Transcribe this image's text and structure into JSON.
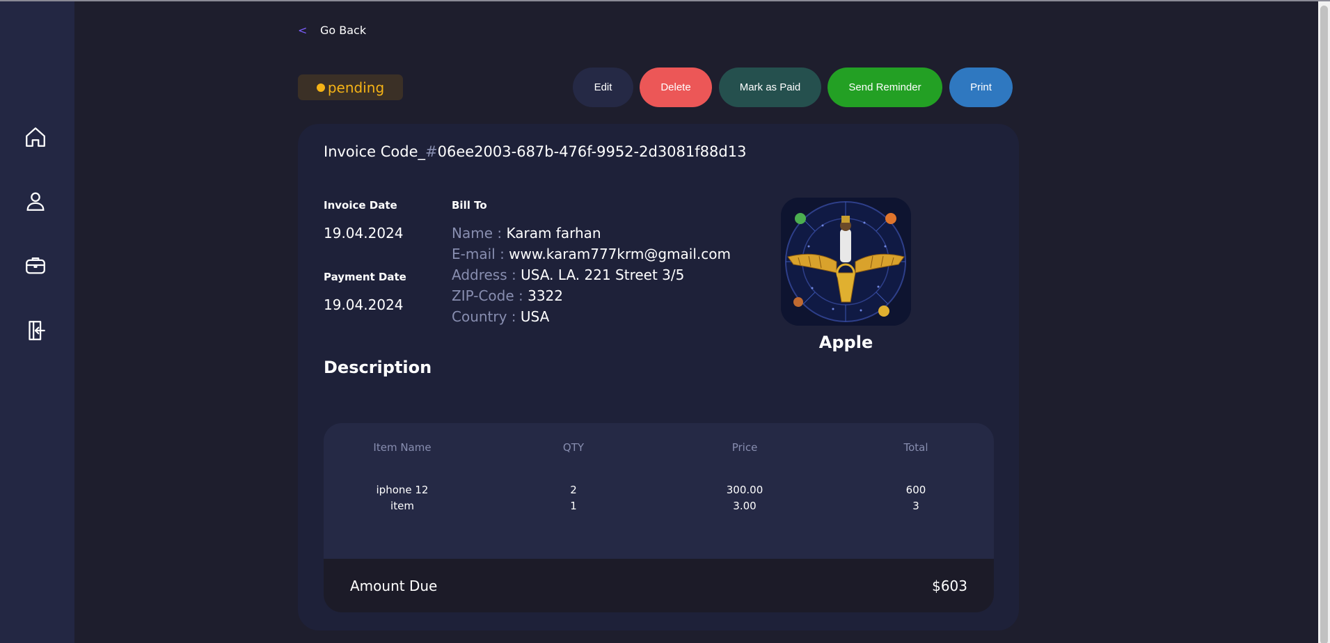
{
  "nav": {
    "go_back": "Go Back",
    "items": [
      "home-icon",
      "user-icon",
      "briefcase-icon",
      "logout-icon"
    ]
  },
  "status": {
    "label": "pending",
    "color": "#f5b316"
  },
  "actions": {
    "edit": "Edit",
    "delete": "Delete",
    "mark_paid": "Mark as Paid",
    "send_reminder": "Send Reminder",
    "print": "Print"
  },
  "invoice": {
    "code_prefix": "Invoice Code_",
    "code_hash": "#",
    "code": "06ee2003-687b-476f-9952-2d3081f88d13",
    "invoice_date_label": "Invoice Date",
    "invoice_date": "19.04.2024",
    "payment_date_label": "Payment Date",
    "payment_date": "19.04.2024",
    "bill_to_label": "Bill To",
    "bill_to": {
      "name_label": "Name :",
      "name": "Karam farhan",
      "email_label": "E-mail :",
      "email": "www.karam777krm@gmail.com",
      "address_label": "Address :",
      "address": "USA. LA. 221 Street 3/5",
      "zip_label": "ZIP-Code :",
      "zip": "3322",
      "country_label": "Country :",
      "country": "USA"
    },
    "company": "Apple",
    "description_title": "Description"
  },
  "items_table": {
    "headers": [
      "Item Name",
      "QTY",
      "Price",
      "Total"
    ],
    "rows": [
      [
        "iphone 12",
        "2",
        "300.00",
        "600"
      ],
      [
        "item",
        "1",
        "3.00",
        "3"
      ]
    ]
  },
  "amount_due": {
    "label": "Amount Due",
    "value": "$603"
  },
  "colors": {
    "accent": "#7c5dfa",
    "delete": "#ec5757",
    "mark_paid": "#25504e",
    "send_reminder": "#23a024",
    "print": "#2f78c0"
  }
}
